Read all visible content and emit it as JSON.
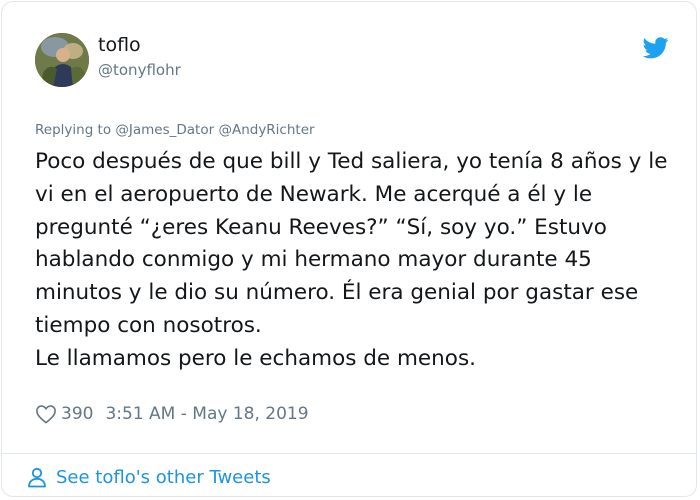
{
  "tweet": {
    "author": {
      "display_name": "toflo",
      "handle": "@tonyflohr"
    },
    "reply_context": "Replying to @James_Dator @AndyRichter",
    "text_paragraphs": [
      "Poco después de que bill y Ted saliera, yo tenía 8 años y le vi en el aeropuerto de Newark. Me acerqué a él y le pregunté “¿eres Keanu Reeves?” “Sí, soy yo.” Estuvo hablando conmigo y mi hermano mayor durante 45 minutos y le dio su número. Él era genial por gastar ese tiempo con nosotros.",
      "Le llamamos pero le echamos de menos."
    ],
    "likes": "390",
    "timestamp": "3:51 AM - May 18, 2019"
  },
  "footer": {
    "link_label": "See toflo's other Tweets"
  },
  "icons": {
    "brand": "twitter-bird-icon",
    "like": "heart-icon",
    "profile": "person-icon"
  },
  "colors": {
    "twitter_blue": "#1da1f2",
    "link_blue": "#1b95e0",
    "secondary_text": "#657786",
    "primary_text": "#14171a",
    "border": "#e1e8ed"
  }
}
